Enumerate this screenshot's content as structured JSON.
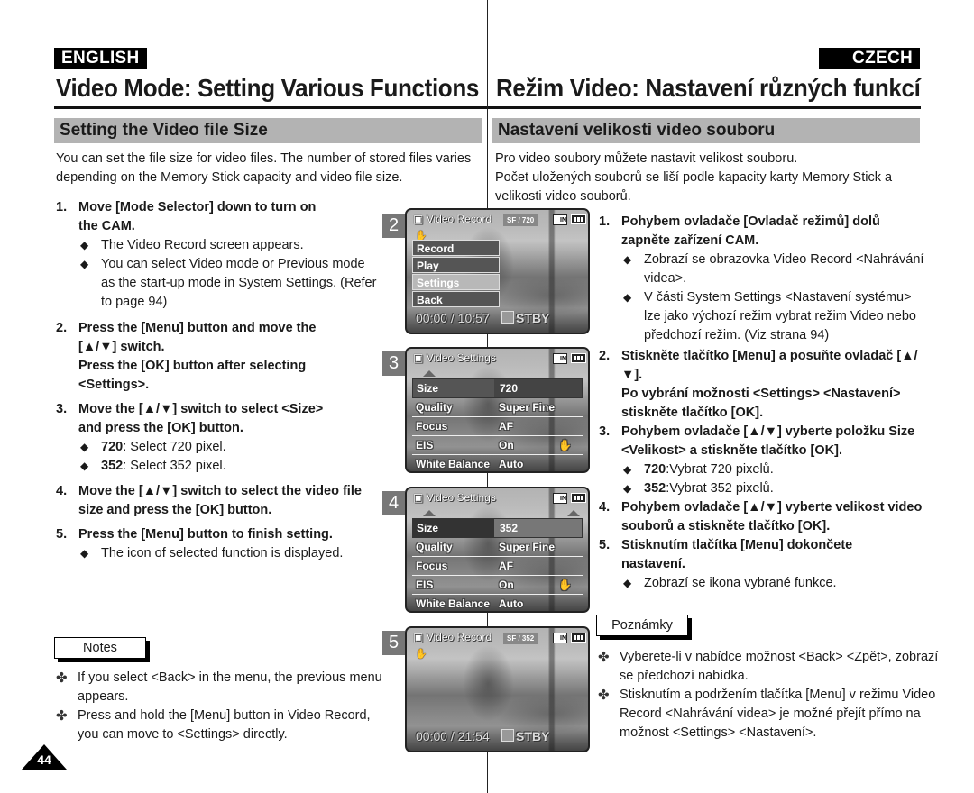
{
  "english": {
    "lang_tag": "ENGLISH",
    "title": "Video Mode: Setting Various Functions",
    "section": "Setting the Video file Size",
    "intro": "You can set the file size for video files. The number of stored files varies depending on the Memory Stick capacity and video file size.",
    "steps": [
      {
        "num": "1.",
        "text": "Move [Mode Selector] down to turn on the CAM.",
        "bullets": [
          "The Video Record screen appears.",
          "You can select Video mode or Previous mode as the start-up mode in System Settings. (Refer to page 94)"
        ]
      },
      {
        "num": "2.",
        "text": "Press the [Menu] button and move the [▲/▼] switch.",
        "text2": "Press the [OK] button after selecting <Settings>."
      },
      {
        "num": "3.",
        "text": "Move the [▲/▼] switch to select <Size> and press the [OK] button.",
        "bullets": [
          {
            "bold": "720",
            "rest": ": Select 720 pixel."
          },
          {
            "bold": "352",
            "rest": ": Select 352 pixel."
          }
        ]
      },
      {
        "num": "4.",
        "text": "Move the [▲/▼] switch to select the video file size and press the [OK] button."
      },
      {
        "num": "5.",
        "text": "Press the [Menu] button to finish setting.",
        "bullets": [
          "The icon of selected function is displayed."
        ]
      }
    ],
    "notes_label": "Notes",
    "notes": [
      "If you select <Back> in the menu, the previous menu appears.",
      "Press and hold the [Menu] button in Video Record, you can move to <Settings> directly."
    ],
    "page_number": "44"
  },
  "czech": {
    "lang_tag": "CZECH",
    "title": "Režim Video: Nastavení různých funkcí",
    "section": "Nastavení velikosti video souboru",
    "intro1": "Pro video soubory můžete nastavit velikost souboru.",
    "intro2": "Počet uložených souborů se liší podle kapacity karty Memory Stick a velikosti video souborů.",
    "steps": [
      {
        "num": "1.",
        "text": "Pohybem ovladače [Ovladač režimů] dolů zapněte zařízení CAM.",
        "bullets": [
          "Zobrazí se obrazovka Video Record <Nahrávání videa>.",
          "V části System Settings <Nastavení systému> lze jako výchozí režim vybrat režim Video nebo předchozí režim. (Viz strana 94)"
        ]
      },
      {
        "num": "2.",
        "text": "Stiskněte tlačítko [Menu] a posuňte ovladač [▲/▼].",
        "text2": "Po vybrání možnosti <Settings> <Nastavení> stiskněte tlačítko [OK]."
      },
      {
        "num": "3.",
        "text": "Pohybem ovladače [▲/▼] vyberte položku Size <Velikost> a stiskněte tlačítko [OK].",
        "bullets": [
          {
            "bold": "720",
            "rest": ":Vybrat 720 pixelů."
          },
          {
            "bold": "352",
            "rest": ":Vybrat 352 pixelů."
          }
        ]
      },
      {
        "num": "4.",
        "text": "Pohybem ovladače [▲/▼] vyberte velikost video souborů a stiskněte tlačítko [OK]."
      },
      {
        "num": "5.",
        "text": "Stisknutím tlačítka [Menu] dokončete nastavení.",
        "bullets": [
          "Zobrazí se ikona vybrané funkce."
        ]
      }
    ],
    "notes_label": "Poznámky",
    "notes": [
      "Vyberete-li v nabídce možnost <Back> <Zpět>, zobrazí se předchozí nabídka.",
      "Stisknutím a podržením tlačítka [Menu] v režimu Video Record <Nahrávání videa> je možné přejít přímo na možnost <Settings> <Nastavení>."
    ]
  },
  "screens": [
    {
      "step": "2",
      "title": "Video Record",
      "badge_quality": "SF",
      "badge_size": "720",
      "card": "IN",
      "menu": [
        "Record",
        "Play",
        "Settings",
        "Back"
      ],
      "selected": "Settings",
      "time": "00:00 / 10:57",
      "status": "STBY"
    },
    {
      "step": "3",
      "title": "Video Settings",
      "card": "IN",
      "rows": [
        {
          "label": "Size",
          "value": "720"
        },
        {
          "label": "Quality",
          "value": "Super Fine"
        },
        {
          "label": "Focus",
          "value": "AF"
        },
        {
          "label": "EIS",
          "value": "On"
        },
        {
          "label": "White Balance",
          "value": "Auto"
        }
      ]
    },
    {
      "step": "4",
      "title": "Video Settings",
      "card": "IN",
      "rows": [
        {
          "label": "Size",
          "value": "352"
        },
        {
          "label": "Quality",
          "value": "Super Fine"
        },
        {
          "label": "Focus",
          "value": "AF"
        },
        {
          "label": "EIS",
          "value": "On"
        },
        {
          "label": "White Balance",
          "value": "Auto"
        }
      ]
    },
    {
      "step": "5",
      "title": "Video Record",
      "badge_quality": "SF",
      "badge_size": "352",
      "card": "IN",
      "time": "00:00 / 21:54",
      "status": "STBY"
    }
  ],
  "glyphs": {
    "diamond": "◆",
    "clover": "✤",
    "camcorder": "🎥",
    "hand": "✋"
  }
}
